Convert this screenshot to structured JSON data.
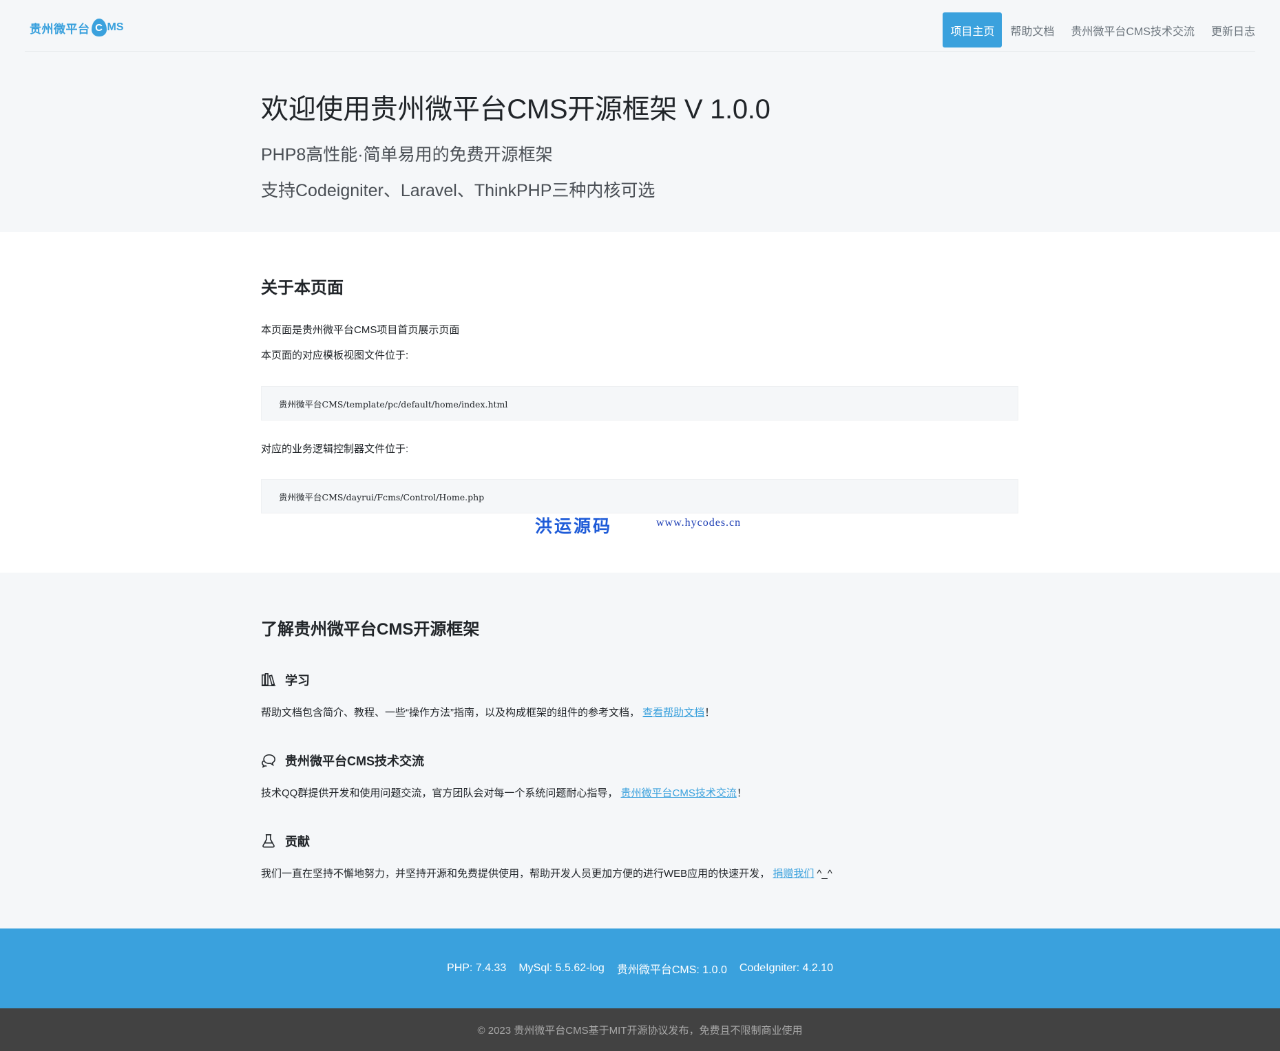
{
  "header": {
    "logo_text": "贵州微平台",
    "logo_c": "C",
    "logo_ms": "MS",
    "nav": [
      {
        "label": "项目主页"
      },
      {
        "label": "帮助文档"
      },
      {
        "label": "贵州微平台CMS技术交流"
      },
      {
        "label": "更新日志"
      }
    ]
  },
  "hero": {
    "title": "欢迎使用贵州微平台CMS开源框架 V 1.0.0",
    "subtitle1": "PHP8高性能·简单易用的免费开源框架",
    "subtitle2": "支持Codeigniter、Laravel、ThinkPHP三种内核可选"
  },
  "about": {
    "title": "关于本页面",
    "line1": "本页面是贵州微平台CMS项目首页展示页面",
    "line2": "本页面的对应模板视图文件位于:",
    "code1": "贵州微平台CMS/template/pc/default/home/index.html",
    "line3": "对应的业务逻辑控制器文件位于:",
    "code2": "贵州微平台CMS/dayrui/Fcms/Control/Home.php",
    "watermark_cn": "洪运源码",
    "watermark_url": "www.hycodes.cn"
  },
  "learn": {
    "title": "了解贵州微平台CMS开源框架",
    "items": [
      {
        "icon": "books-icon",
        "heading": "学习",
        "text": "帮助文档包含简介、教程、一些“操作方法”指南，以及构成框架的组件的参考文档，",
        "link": "查看帮助文档",
        "suffix": "！"
      },
      {
        "icon": "chat-bubbles-icon",
        "heading": "贵州微平台CMS技术交流",
        "text": "技术QQ群提供开发和使用问题交流，官方团队会对每一个系统问题耐心指导，",
        "link": "贵州微平台CMS技术交流",
        "suffix": "！"
      },
      {
        "icon": "flask-icon",
        "heading": "贡献",
        "text": "我们一直在坚持不懈地努力，并坚持开源和免费提供使用，帮助开发人员更加方便的进行WEB应用的快速开发，",
        "link": "捐赠我们",
        "suffix": "^_^"
      }
    ]
  },
  "footer": {
    "php": "PHP: 7.4.33",
    "mysql": "MySql: 5.5.62-log",
    "cms": "贵州微平台CMS: 1.0.0",
    "ci": "CodeIgniter: 4.2.10",
    "copyright": "© 2023 贵州微平台CMS基于MIT开源协议发布，免费且不限制商业使用"
  },
  "colors": {
    "accent": "#3aa1dd",
    "light_bg": "#f5f7f9",
    "footer_dark": "#424242",
    "watermark": "#1e5bd8"
  }
}
